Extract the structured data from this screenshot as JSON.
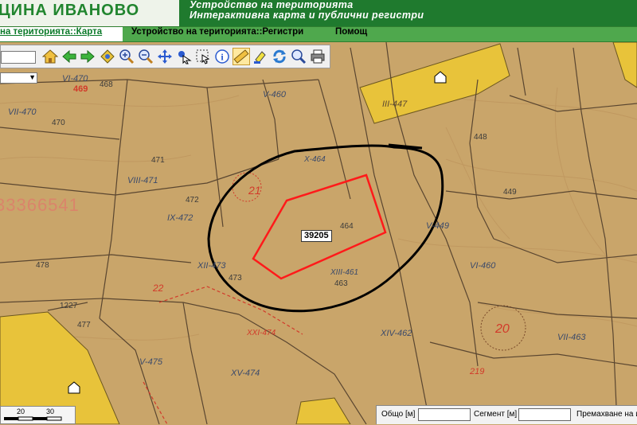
{
  "header": {
    "brand": "ЦИНА ИВАНОВО",
    "subtitle_line1": "Устройство на територията",
    "subtitle_line2": "Интерактивна карта и публични регистри"
  },
  "menu": {
    "map": "на територията::Карта",
    "registers": "Устройство на територията::Регистри",
    "help": "Помощ"
  },
  "toolbar": {
    "icons": [
      "home-icon",
      "back-arrow-icon",
      "forward-arrow-icon",
      "pan-diamond-icon",
      "zoom-in-icon",
      "zoom-out-icon",
      "move-icon",
      "identify-icon",
      "select-area-icon",
      "info-icon",
      "measure-ruler-icon",
      "highlight-icon",
      "refresh-icon",
      "search-icon",
      "print-icon"
    ]
  },
  "map": {
    "parcel_id": "39205",
    "watermark_number": "33366541",
    "annotations": {
      "top_left_code": "VI-470",
      "top_left_red": "469",
      "block_468": "468",
      "roman_460": "V-460",
      "roman_464": "X-464",
      "roman_447": "III-447",
      "roman_461": "XIII-461",
      "roman_462": "XIV-462",
      "roman_473": "XII-473",
      "roman_472": "IX-472",
      "roman_471": "VIII-471",
      "roman_470": "VII-470",
      "roman_474": "XV-474",
      "roman_475": "V-475",
      "roman_449": "V-449",
      "roman_460b": "VI-460",
      "roman_463": "VII-463",
      "num_470": "470",
      "num_471": "471",
      "num_472": "472",
      "num_473": "473",
      "num_478": "478",
      "num_463": "463",
      "num_448": "448",
      "num_449": "449",
      "num_464": "464",
      "num_1227": "1227",
      "num_477": "477",
      "red_21": "21",
      "red_20": "20",
      "red_219": "219",
      "red_22": "22",
      "red_xxi": "XXI-474"
    }
  },
  "scalebar": {
    "ticks": [
      "20",
      "30"
    ]
  },
  "measure": {
    "total_label": "Общо [м]",
    "segment_label": "Сегмент [м]",
    "snap_label": "Премахване на и",
    "total_value": "",
    "segment_value": ""
  },
  "colors": {
    "header_green": "#1f7a2e",
    "menu_green": "#4fa84d",
    "map_base": "#c9a56a",
    "parcel_yellow": "#e8c33a",
    "selection_red": "#ff1a1a",
    "circle_black": "#000000"
  }
}
